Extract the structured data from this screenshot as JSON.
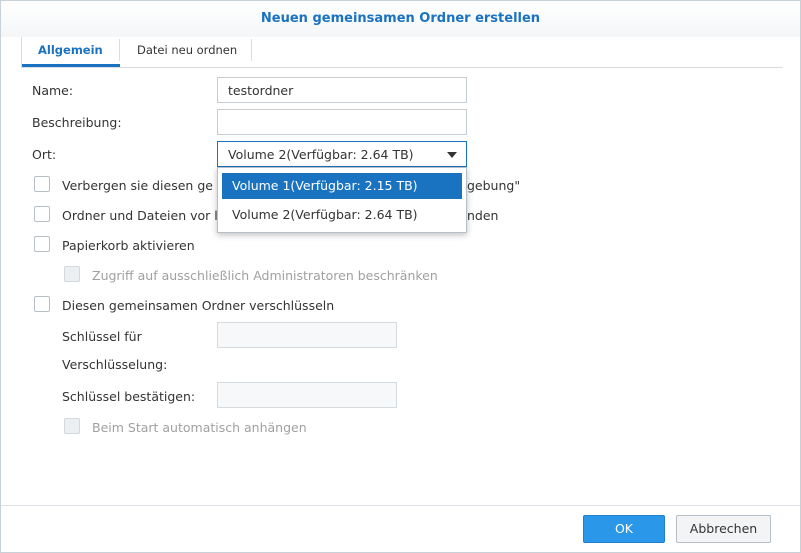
{
  "dialog": {
    "title": "Neuen gemeinsamen Ordner erstellen"
  },
  "tabs": [
    {
      "label": "Allgemein",
      "active": true
    },
    {
      "label": "Datei neu ordnen",
      "active": false
    }
  ],
  "form": {
    "name_label": "Name:",
    "name_value": "testordner",
    "description_label": "Beschreibung:",
    "description_value": "",
    "location_label": "Ort:",
    "location_value": "Volume 2(Verfügbar: 2.64 TB)",
    "location_options": [
      {
        "label": "Volume 1(Verfügbar: 2.15 TB)",
        "highlighted": true
      },
      {
        "label": "Volume 2(Verfügbar: 2.64 TB)",
        "highlighted": false
      }
    ],
    "hide_label_left": "Verbergen sie diesen ge",
    "hide_label_right": "gebung\"",
    "hide_checked": false,
    "hide_files_label_left": "Ordner und Dateien vor l",
    "hide_files_label_right": "nden",
    "hide_files_checked": false,
    "recycle_label": "Papierkorb aktivieren",
    "recycle_checked": false,
    "restrict_admin_label": "Zugriff auf ausschließlich Administratoren beschränken",
    "restrict_admin_checked": false,
    "encrypt_label": "Diesen gemeinsamen Ordner verschlüsseln",
    "encrypt_checked": false,
    "key_label_line1": "Schlüssel für",
    "key_label_line2": "Verschlüsselung:",
    "key_value": "",
    "confirm_key_label": "Schlüssel bestätigen:",
    "confirm_key_value": "",
    "auto_mount_label": "Beim Start automatisch anhängen",
    "auto_mount_checked": false
  },
  "footer": {
    "ok_label": "OK",
    "cancel_label": "Abbrechen"
  },
  "colors": {
    "accent": "#1a73c1",
    "primary_button": "#2b97e8"
  }
}
